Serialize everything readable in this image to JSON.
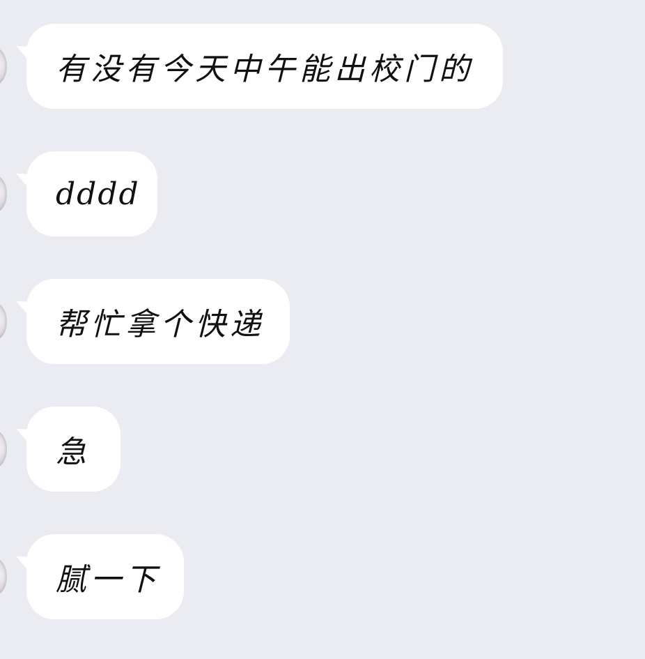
{
  "conversation": {
    "messages": [
      {
        "text": "有没有今天中午能出校门的"
      },
      {
        "text": "dddd"
      },
      {
        "text": "帮忙拿个快递"
      },
      {
        "text": "急"
      },
      {
        "text": "腻一下"
      }
    ]
  },
  "colors": {
    "background": "#ebecf1",
    "bubble": "#ffffff",
    "text": "#111111"
  }
}
